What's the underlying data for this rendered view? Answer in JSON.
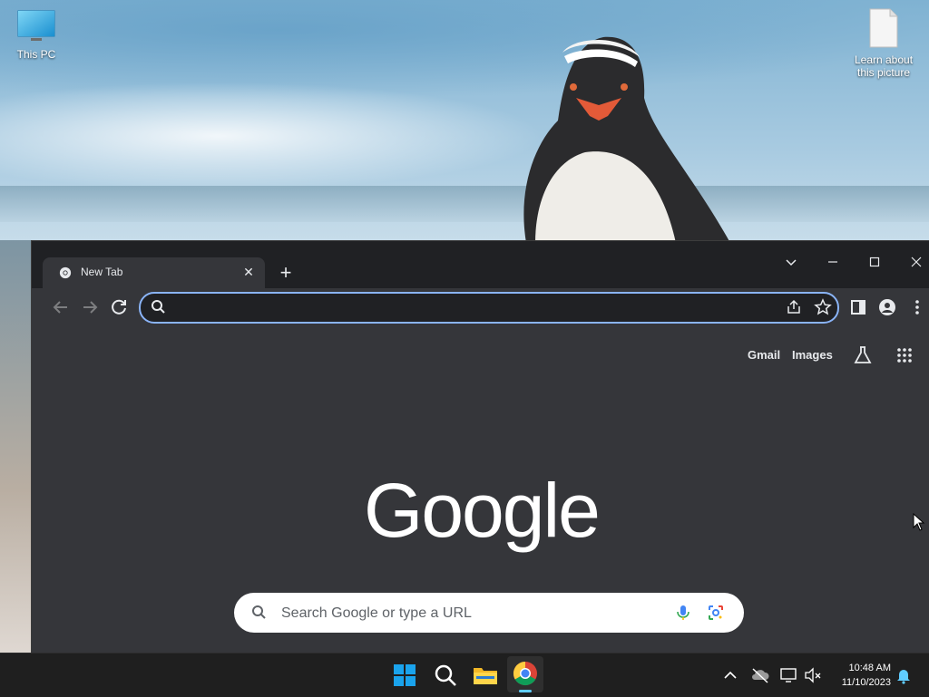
{
  "desktop": {
    "icons": [
      {
        "label": "This PC"
      },
      {
        "label": "Learn about this picture"
      }
    ]
  },
  "browser": {
    "tab": {
      "title": "New Tab"
    },
    "address_bar": {
      "value": "",
      "placeholder": ""
    },
    "accent": "#8ab4f8"
  },
  "newtab_page": {
    "links": {
      "gmail": "Gmail",
      "images": "Images"
    },
    "logo_text": "Google",
    "search": {
      "placeholder": "Search Google or type a URL"
    }
  },
  "taskbar": {
    "time": "10:48 AM",
    "date": "11/10/2023"
  }
}
